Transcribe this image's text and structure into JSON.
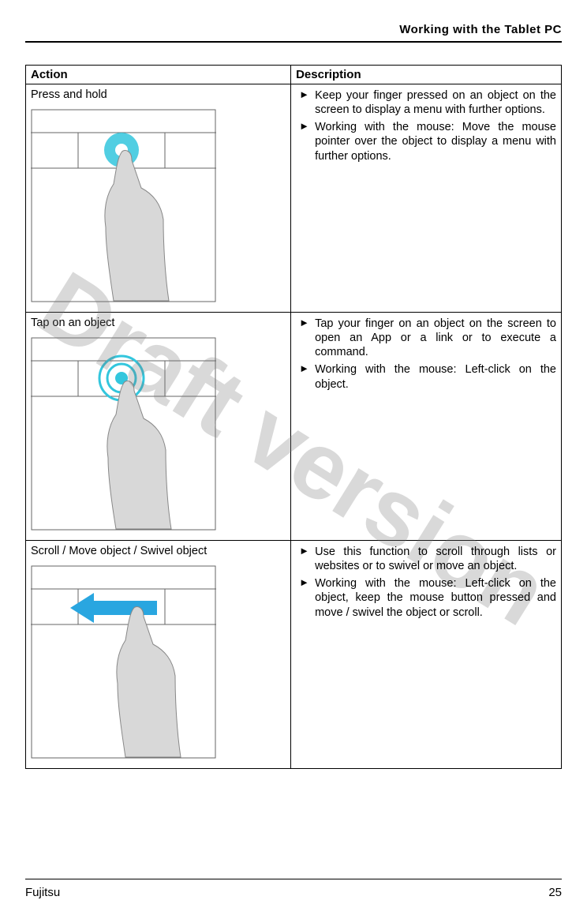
{
  "header": {
    "title": "Working with the Tablet PC"
  },
  "watermark": "Draft version",
  "table": {
    "header": {
      "action": "Action",
      "description": "Description"
    },
    "rows": [
      {
        "action": "Press and hold",
        "desc": [
          "Keep your finger pressed on an object on the screen to display a menu with further options.",
          "Working with the mouse: Move the mouse pointer over the object to display a menu with further options."
        ]
      },
      {
        "action": "Tap on an object",
        "desc": [
          "Tap your finger on an object on the screen to open an App or a link or to execute a command.",
          "Working with the mouse: Left-click on the object."
        ]
      },
      {
        "action": "Scroll / Move object / Swivel object",
        "desc": [
          "Use this function to scroll through lists or websites or to swivel or move an object.",
          "Working with the mouse: Left-click on the object, keep the mouse button pressed and move / swivel the object or scroll."
        ]
      }
    ]
  },
  "footer": {
    "brand": "Fujitsu",
    "page": "25"
  }
}
